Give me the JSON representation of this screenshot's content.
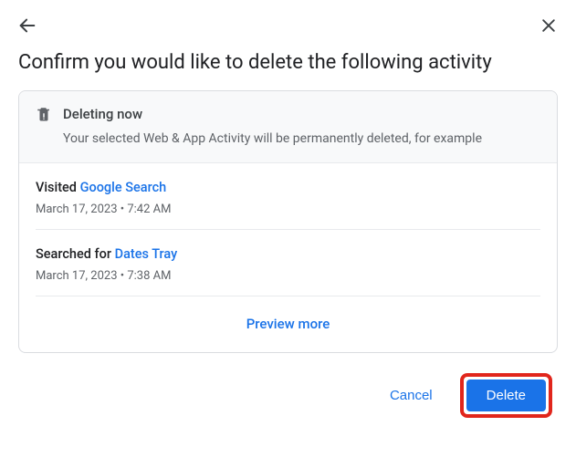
{
  "header": {
    "title": "Confirm you would like to delete the following activity"
  },
  "banner": {
    "title": "Deleting now",
    "subtitle": "Your selected Web & App Activity will be permanently deleted, for example"
  },
  "items": [
    {
      "prefix": "Visited ",
      "link": "Google Search",
      "meta": "March 17, 2023 • 7:42 AM"
    },
    {
      "prefix": "Searched for ",
      "link": "Dates Tray",
      "meta": "March 17, 2023 • 7:38 AM"
    }
  ],
  "preview_more": "Preview more",
  "actions": {
    "cancel": "Cancel",
    "delete": "Delete"
  }
}
